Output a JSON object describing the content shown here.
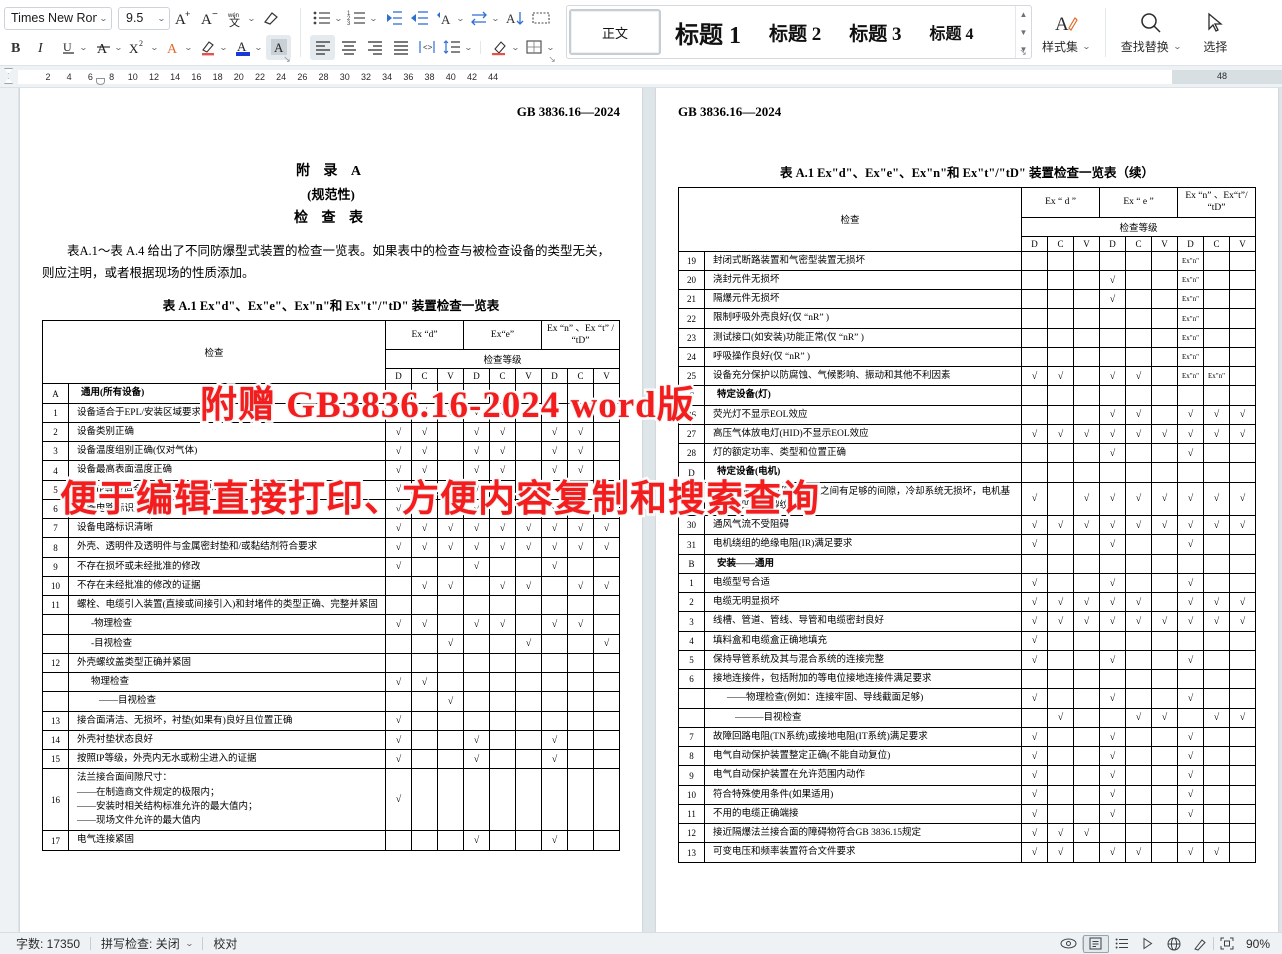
{
  "ribbon": {
    "font_name": "Times New Roma",
    "font_size": "9.5",
    "buttons": {
      "grow_font": "A+",
      "shrink_font": "A-",
      "phonetic_guide": "文",
      "clear_format": "clear-format",
      "italic": "I",
      "underline": "U",
      "strikethrough": "A",
      "superscript": "X²",
      "text_effects": "A",
      "highlight": "A",
      "font_color": "A",
      "char_shading": "A",
      "bullets": "bullets",
      "numbering": "numbering",
      "decrease_indent": "decrease-indent",
      "increase_indent": "increase-indent",
      "chinese_layout": "chinese-layout",
      "ltr_rtl": "text-direction",
      "sort": "sort",
      "show_marks": "show-marks",
      "align_left": "align-left",
      "align_center": "align-center",
      "align_right": "align-right",
      "justify": "justify",
      "distribute": "distribute",
      "line_spacing": "line-spacing",
      "shading": "shading",
      "borders": "borders"
    },
    "styles_gallery": [
      {
        "label": "正文",
        "active": true
      },
      {
        "label": "标题 1",
        "active": false
      },
      {
        "label": "标题 2",
        "active": false
      },
      {
        "label": "标题 3",
        "active": false
      },
      {
        "label": "标题 4",
        "active": false
      }
    ],
    "style_set": "样式集",
    "find_replace": "查找替换",
    "select": "选择"
  },
  "ruler": {
    "ticks": [
      "2",
      "4",
      "6",
      "8",
      "10",
      "12",
      "14",
      "16",
      "18",
      "20",
      "22",
      "24",
      "26",
      "28",
      "30",
      "32",
      "34",
      "36",
      "38",
      "40",
      "42",
      "44"
    ],
    "grey_tick": "48"
  },
  "document": {
    "left_page": {
      "header": "GB 3836.16—2024",
      "annex_title": "附 录 A",
      "annex_sub": "(规范性)",
      "annex_sub2": "检 查 表",
      "paragraph": "表A.1～表 A.4 给出了不同防爆型式装置的检查一览表。如果表中的检查与被检查设备的类型无关，则应注明，或者根据现场的性质添加。",
      "table_title": "表 A.1 Ex\"d\"、Ex\"e\"、Ex\"n\"和 Ex\"t\"/\"tD\" 装置检查一览表",
      "col_inspect": "检查",
      "col_exd": "Ex “d”",
      "col_exe": "Ex“e”",
      "col_exn": "Ex “n” 、Ex “t” / “tD”",
      "col_grade": "检查等级",
      "sub_d": "D",
      "sub_c": "C",
      "sub_v": "V",
      "rows": [
        {
          "num": "A",
          "text": "通用(所有设备)",
          "section": true,
          "marks": [
            "",
            "",
            "",
            "",
            "",
            "",
            "",
            "",
            ""
          ]
        },
        {
          "num": "1",
          "text": "设备适合于EPL/安装区域要求",
          "marks": [
            "√",
            "√",
            "√",
            "√",
            "√",
            "√",
            "√",
            "√",
            "√"
          ]
        },
        {
          "num": "2",
          "text": "设备类别正确",
          "marks": [
            "√",
            "√",
            "",
            "√",
            "√",
            "",
            "√",
            "√",
            ""
          ]
        },
        {
          "num": "3",
          "text": "设备温度组别正确(仅对气体)",
          "marks": [
            "√",
            "√",
            "",
            "√",
            "√",
            "",
            "√",
            "√",
            ""
          ]
        },
        {
          "num": "4",
          "text": "设备最高表面温度正确",
          "marks": [
            "√",
            "√",
            "",
            "√",
            "√",
            "",
            "√",
            "√",
            ""
          ]
        },
        {
          "num": "5",
          "text": "设备IP等级适合于保护等级/类别/导电性",
          "marks": [
            "√",
            "√",
            "√",
            "√",
            "√",
            "√",
            "√",
            "√",
            "√"
          ]
        },
        {
          "num": "6",
          "text": "设备电路标识正确",
          "marks": [
            "√",
            "",
            "",
            "√",
            "",
            "",
            "√",
            "",
            ""
          ]
        },
        {
          "num": "7",
          "text": "设备电路标识清晰",
          "marks": [
            "√",
            "√",
            "√",
            "√",
            "√",
            "√",
            "√",
            "√",
            "√"
          ]
        },
        {
          "num": "8",
          "text": "外壳、透明件及透明件与金属密封垫和/或黏结剂符合要求",
          "marks": [
            "√",
            "√",
            "√",
            "√",
            "√",
            "√",
            "√",
            "√",
            "√"
          ]
        },
        {
          "num": "9",
          "text": "不存在损坏或未经批准的修改",
          "marks": [
            "√",
            "",
            "",
            "√",
            "",
            "",
            "√",
            "",
            ""
          ]
        },
        {
          "num": "10",
          "text": "不存在未经批准的修改的证据",
          "marks": [
            "",
            "√",
            "√",
            "",
            "√",
            "√",
            "",
            "√",
            "√"
          ]
        },
        {
          "num": "11",
          "text": "螺栓、电缆引入装置(直接或间接引入)和封堵件的类型正确、完整并紧固",
          "rowspan_group": true,
          "marks": [
            "",
            "",
            "",
            "",
            "",
            "",
            "",
            "",
            ""
          ]
        },
        {
          "num": "",
          "text": "-物理检查",
          "indent": 1,
          "marks": [
            "√",
            "√",
            "",
            "√",
            "√",
            "",
            "√",
            "√",
            ""
          ]
        },
        {
          "num": "",
          "text": "-目视检查",
          "indent": 1,
          "marks": [
            "",
            "",
            "√",
            "",
            "",
            "√",
            "",
            "",
            "√"
          ]
        },
        {
          "num": "12",
          "text": "外壳螺纹盖类型正确并紧固",
          "marks": [
            "",
            "",
            "",
            "",
            "",
            "",
            "",
            "",
            ""
          ]
        },
        {
          "num": "",
          "text": "物理检查",
          "indent": 1,
          "marks": [
            "√",
            "√",
            "",
            "",
            "",
            "",
            "",
            "",
            ""
          ]
        },
        {
          "num": "",
          "text": "——目视检查",
          "indent": 2,
          "marks": [
            "",
            "",
            "√",
            "",
            "",
            "",
            "",
            "",
            ""
          ]
        },
        {
          "num": "13",
          "text": "接合面清洁、无损坏，衬垫(如果有)良好且位置正确",
          "marks": [
            "√",
            "",
            "",
            "",
            "",
            "",
            "",
            "",
            ""
          ]
        },
        {
          "num": "14",
          "text": "外壳衬垫状态良好",
          "marks": [
            "√",
            "",
            "",
            "√",
            "",
            "",
            "√",
            "",
            ""
          ]
        },
        {
          "num": "15",
          "text": "按照IP等级，外壳内无水或粉尘进入的证据",
          "marks": [
            "√",
            "",
            "",
            "√",
            "",
            "",
            "√",
            "",
            ""
          ]
        },
        {
          "num": "16",
          "text": "法兰接合面间隙尺寸：\n——在制造商文件规定的极限内；\n——安装时相关结构标准允许的最大值内；\n——现场文件允许的最大值内",
          "multiline": true,
          "marks": [
            "√",
            "",
            "",
            "",
            "",
            "",
            "",
            "",
            ""
          ]
        },
        {
          "num": "17",
          "text": "电气连接紧固",
          "marks": [
            "",
            "",
            "",
            "√",
            "",
            "",
            "√",
            "",
            ""
          ]
        }
      ]
    },
    "right_page": {
      "header": "GB 3836.16—2024",
      "table_title": "表 A.1 Ex\"d\"、Ex\"e\"、Ex\"n\"和 Ex\"t\"/\"tD\" 装置检查一览表（续）",
      "col_inspect": "检查",
      "col_exd": "Ex “ d ”",
      "col_exe": "Ex “ e ”",
      "col_exn": "Ex “n” 、Ex“t”/ “tD”",
      "col_grade": "检查等级",
      "sub_d": "D",
      "sub_c": "C",
      "sub_v": "V",
      "rows": [
        {
          "num": "19",
          "text": "封闭式断路装置和气密型装置无损坏",
          "marks": [
            "",
            "",
            "",
            "",
            "",
            "",
            "Ex\"n\"",
            "",
            ""
          ]
        },
        {
          "num": "20",
          "text": "浇封元件无损坏",
          "marks": [
            "",
            "",
            "",
            "√",
            "",
            "",
            "Ex\"n\"",
            "",
            ""
          ]
        },
        {
          "num": "21",
          "text": "隔爆元件无损坏",
          "marks": [
            "",
            "",
            "",
            "√",
            "",
            "",
            "Ex\"n\"",
            "",
            ""
          ]
        },
        {
          "num": "22",
          "text": "限制呼吸外壳良好(仅 “nR” )",
          "marks": [
            "",
            "",
            "",
            "",
            "",
            "",
            "Ex\"n\"",
            "",
            ""
          ]
        },
        {
          "num": "23",
          "text": "测试接口(如安装)功能正常(仅 “nR” )",
          "marks": [
            "",
            "",
            "",
            "",
            "",
            "",
            "Ex\"n\"",
            "",
            ""
          ]
        },
        {
          "num": "24",
          "text": "呼吸操作良好(仅 “nR” )",
          "marks": [
            "",
            "",
            "",
            "",
            "",
            "",
            "Ex\"n\"",
            "",
            ""
          ]
        },
        {
          "num": "25",
          "text": "设备充分保护以防腐蚀、气候影响、振动和其他不利因素",
          "marks": [
            "√",
            "√",
            "",
            "√",
            "√",
            "",
            "Ex\"n\"",
            "Ex\"n\"",
            ""
          ]
        },
        {
          "num": "C",
          "text": "特定设备(灯)",
          "section": true,
          "marks": [
            "",
            "",
            "",
            "",
            "",
            "",
            "",
            "",
            ""
          ]
        },
        {
          "num": "26",
          "text": "荧光灯不显示EOL效应",
          "marks": [
            "",
            "",
            "",
            "√",
            "√",
            "",
            "√",
            "√",
            "√"
          ]
        },
        {
          "num": "27",
          "text": "高压气体放电灯(HID)不显示EOL效应",
          "marks": [
            "√",
            "√",
            "√",
            "√",
            "√",
            "√",
            "√",
            "√",
            "√"
          ]
        },
        {
          "num": "28",
          "text": "灯的额定功率、类型和位置正确",
          "marks": [
            "",
            "",
            "",
            "√",
            "",
            "",
            "√",
            "",
            ""
          ]
        },
        {
          "num": "D",
          "text": "特定设备(电机)",
          "section": true,
          "marks": [
            "",
            "",
            "",
            "",
            "",
            "",
            "",
            "",
            ""
          ]
        },
        {
          "num": "29",
          "text": "电机风扇与外壳和/或外罩之间有足够的间隙，冷却系统无损坏，电机基础没有凹痕或裂纹",
          "multiline": true,
          "marks": [
            "√",
            "",
            "√",
            "√",
            "√",
            "√",
            "√",
            "√",
            "√"
          ]
        },
        {
          "num": "30",
          "text": "通风气流不受阻碍",
          "marks": [
            "√",
            "√",
            "√",
            "√",
            "√",
            "√",
            "√",
            "√",
            "√"
          ]
        },
        {
          "num": "31",
          "text": "电机绕组的绝缘电阻(IR)满足要求",
          "marks": [
            "√",
            "",
            "",
            "√",
            "",
            "",
            "√",
            "",
            ""
          ]
        },
        {
          "num": "B",
          "text": "安装——通用",
          "section": true,
          "marks": [
            "",
            "",
            "",
            "",
            "",
            "",
            "",
            "",
            ""
          ]
        },
        {
          "num": "1",
          "text": "电缆型号合适",
          "marks": [
            "√",
            "",
            "",
            "√",
            "",
            "",
            "√",
            "",
            ""
          ]
        },
        {
          "num": "2",
          "text": "电缆无明显损坏",
          "marks": [
            "√",
            "√",
            "√",
            "√",
            "√",
            "",
            "√",
            "√",
            "√"
          ]
        },
        {
          "num": "3",
          "text": "线槽、管道、管线、导管和电缆密封良好",
          "marks": [
            "√",
            "√",
            "√",
            "√",
            "√",
            "√",
            "√",
            "√",
            "√"
          ]
        },
        {
          "num": "4",
          "text": "填料盒和电缆盒正确地填充",
          "marks": [
            "√",
            "",
            "",
            "",
            "",
            "",
            "",
            "",
            ""
          ]
        },
        {
          "num": "5",
          "text": "保持导管系统及其与混合系统的连接完整",
          "marks": [
            "√",
            "",
            "",
            "√",
            "",
            "",
            "√",
            "",
            ""
          ]
        },
        {
          "num": "6",
          "text": "接地连接件，包括附加的等电位接地连接件满足要求",
          "marks": [
            "",
            "",
            "",
            "",
            "",
            "",
            "",
            "",
            ""
          ]
        },
        {
          "num": "",
          "text": "——物理检查(例如：连接牢固、导线截面足够)",
          "indent": 1,
          "marks": [
            "√",
            "",
            "",
            "√",
            "",
            "",
            "√",
            "",
            ""
          ]
        },
        {
          "num": "",
          "text": "———目视检查",
          "indent": 2,
          "marks": [
            "",
            "√",
            "",
            "",
            "√",
            "√",
            "",
            "√",
            "√"
          ]
        },
        {
          "num": "7",
          "text": "故障回路电阻(TN系统)或接地电阻(IT系统)满足要求",
          "marks": [
            "√",
            "",
            "",
            "√",
            "",
            "",
            "√",
            "",
            ""
          ]
        },
        {
          "num": "8",
          "text": "电气自动保护装置整定正确(不能自动复位)",
          "marks": [
            "√",
            "",
            "",
            "√",
            "",
            "",
            "√",
            "",
            ""
          ]
        },
        {
          "num": "9",
          "text": "电气自动保护装置在允许范围内动作",
          "marks": [
            "√",
            "",
            "",
            "√",
            "",
            "",
            "√",
            "",
            ""
          ]
        },
        {
          "num": "10",
          "text": "符合特殊使用条件(如果适用)",
          "marks": [
            "√",
            "",
            "",
            "√",
            "",
            "",
            "√",
            "",
            ""
          ]
        },
        {
          "num": "11",
          "text": "不用的电缆正确端接",
          "marks": [
            "√",
            "",
            "",
            "√",
            "",
            "",
            "√",
            "",
            ""
          ]
        },
        {
          "num": "12",
          "text": "接近隔爆法兰接合面的障碍物符合GB 3836.15规定",
          "marks": [
            "√",
            "√",
            "√",
            "",
            "",
            "",
            "",
            "",
            ""
          ]
        },
        {
          "num": "13",
          "text": "可变电压和频率装置符合文件要求",
          "marks": [
            "√",
            "√",
            "",
            "√",
            "√",
            "",
            "√",
            "√",
            ""
          ]
        }
      ]
    }
  },
  "watermark": {
    "line1": "附赠 GB3836.16-2024 word版",
    "line2": "便于编辑直接打印、方便内容复制和搜索查询",
    "color": "#f41c1c"
  },
  "statusbar": {
    "word_count": "字数: 17350",
    "spell_check": "拼写检查: 关闭",
    "proofread": "校对",
    "zoom": "90%",
    "icons": [
      "eye-icon",
      "print-layout-icon",
      "outline-icon",
      "web-layout-icon",
      "globe-icon",
      "pen-icon",
      "fullscreen-icon"
    ]
  }
}
